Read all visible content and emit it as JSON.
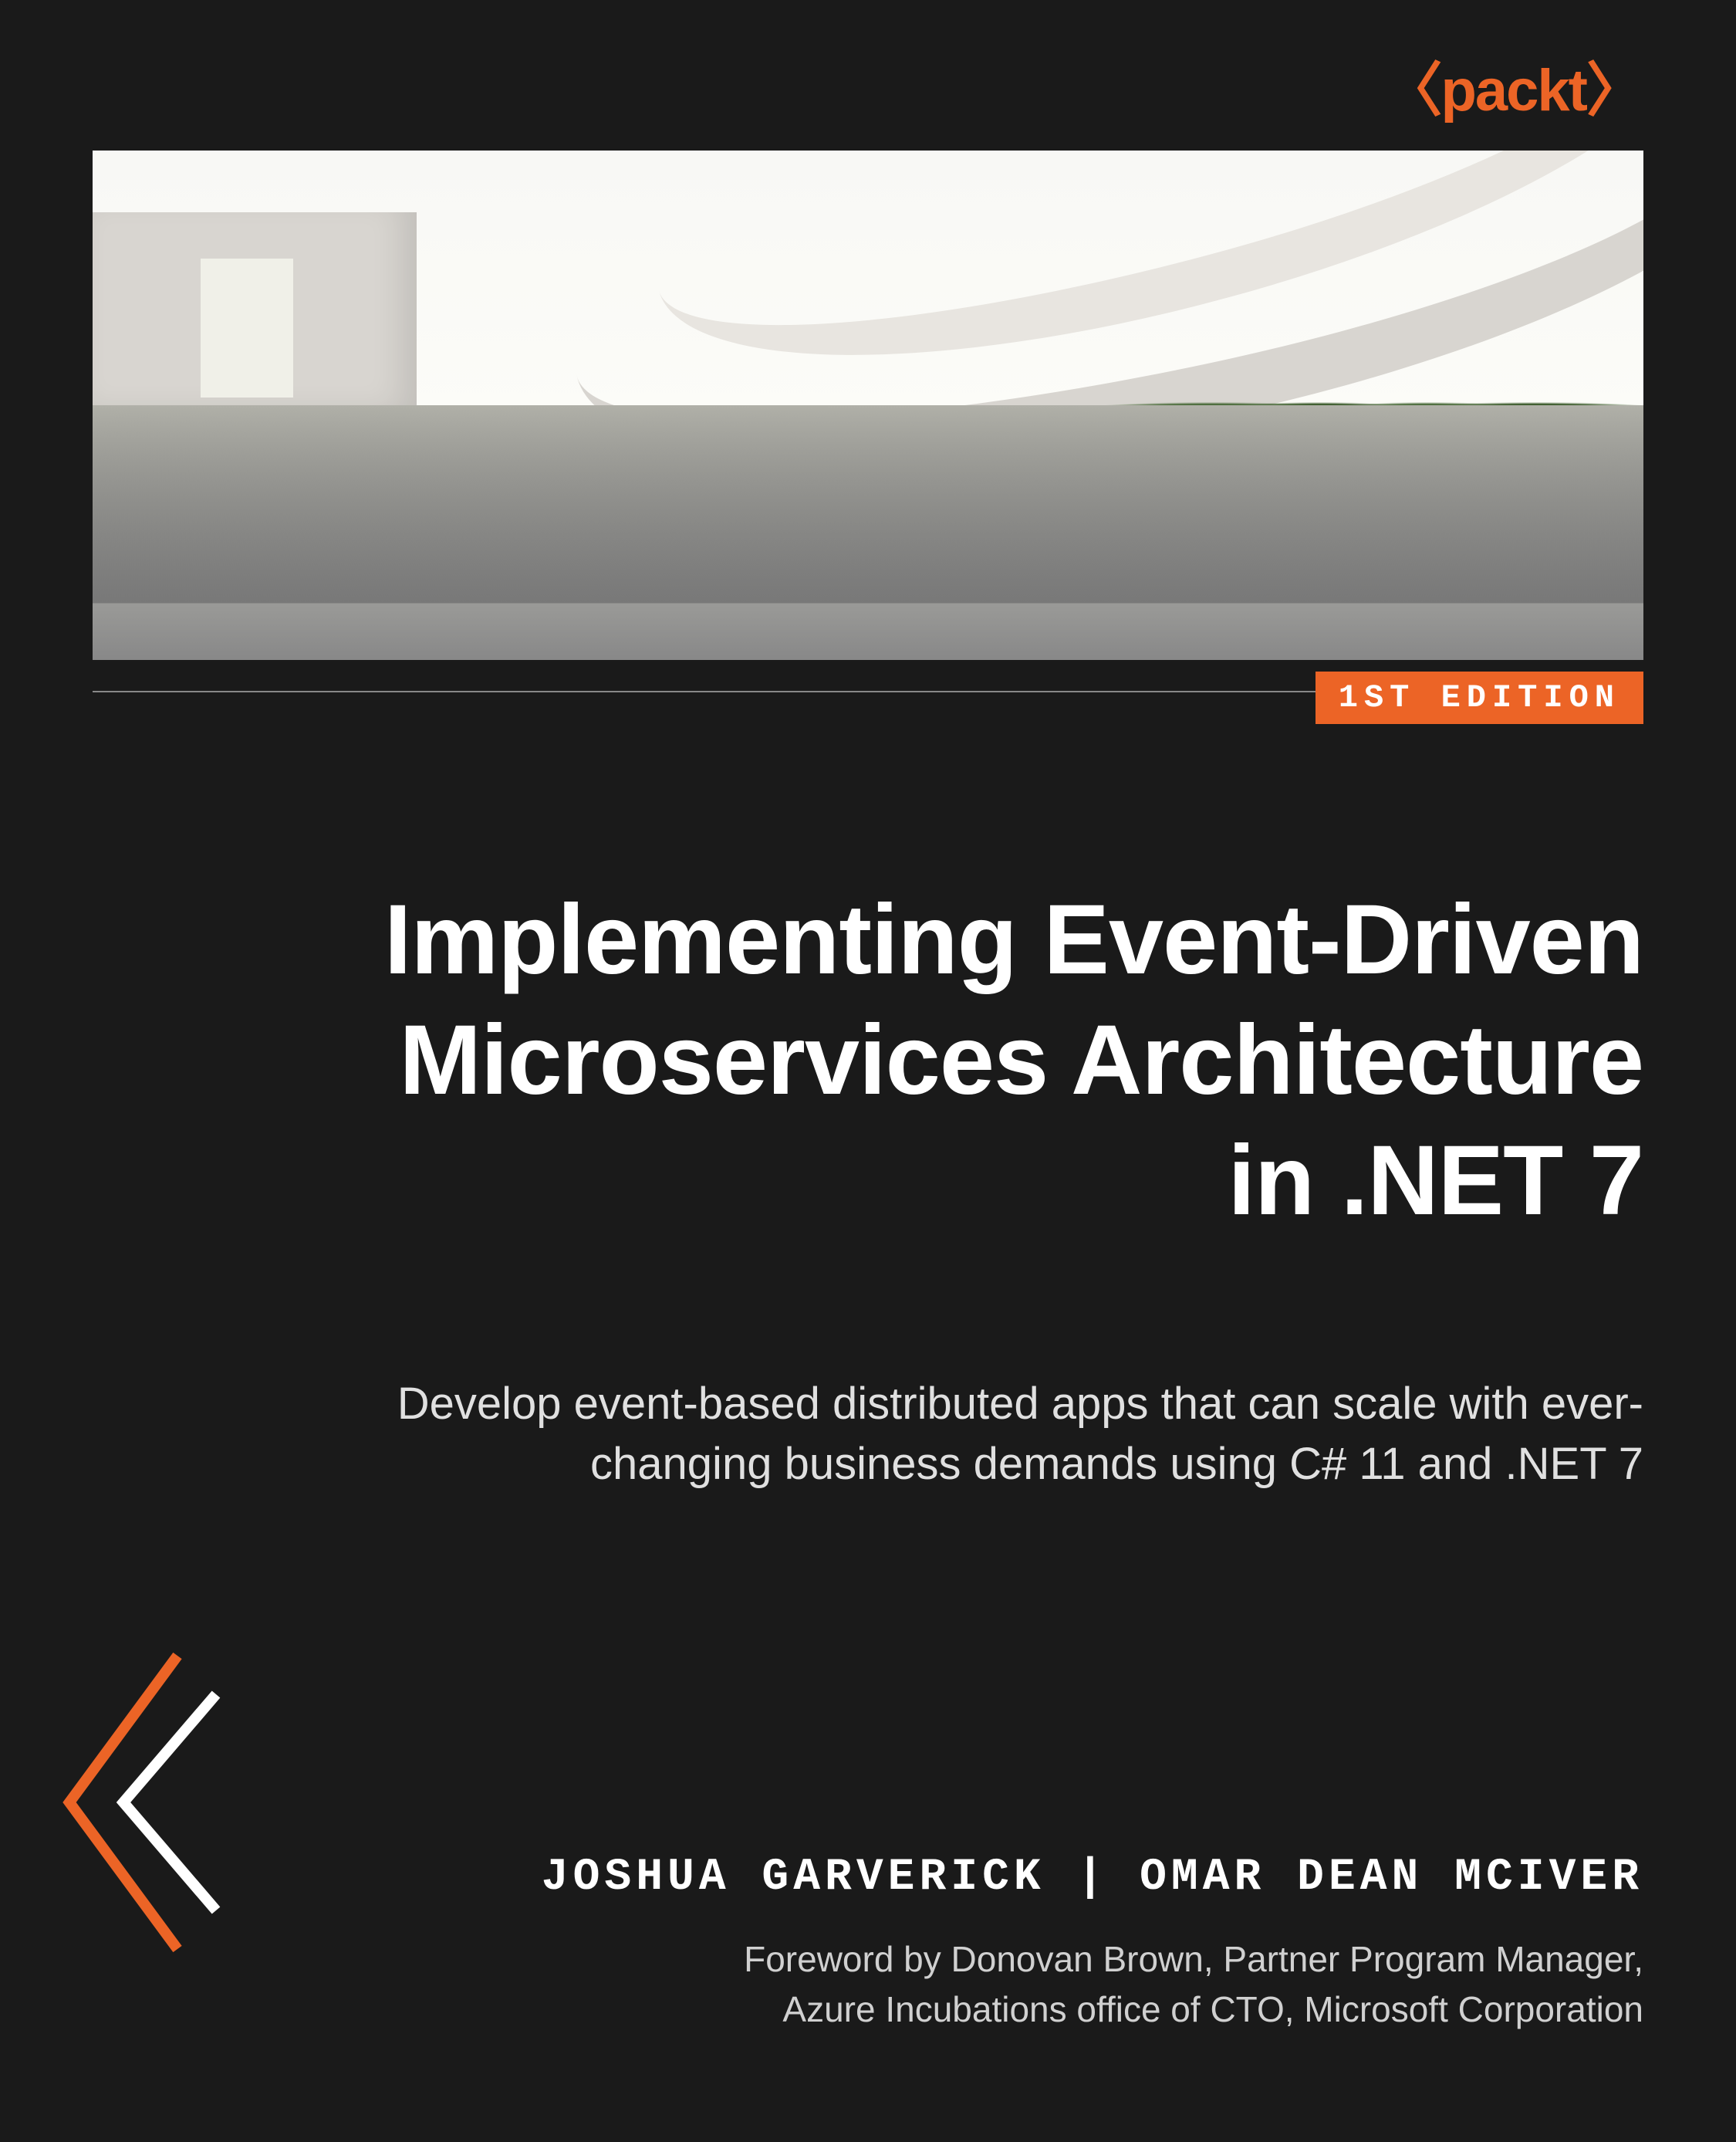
{
  "publisher": "〈packt〉",
  "edition": "1ST EDITION",
  "title_line1": "Implementing Event-Driven",
  "title_line2": "Microservices Architecture",
  "title_line3": "in .NET 7",
  "subtitle": "Develop event-based distributed apps that can scale with ever-changing business demands using C# 11 and .NET 7",
  "author1": "JOSHUA GARVERICK",
  "author_separator": " | ",
  "author2": "OMAR DEAN MCIVER",
  "foreword_line1": "Foreword by Donovan Brown, Partner Program Manager,",
  "foreword_line2": "Azure Incubations office of CTO, Microsoft Corporation",
  "colors": {
    "accent": "#ec6426",
    "background": "#1a1a1a"
  }
}
